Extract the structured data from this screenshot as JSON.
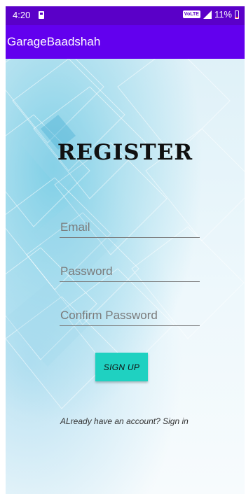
{
  "status_bar": {
    "time": "4:20",
    "network_badge": "VoLTE",
    "battery": "11%",
    "icons": [
      "sd-card-icon",
      "signal-icon",
      "battery-icon"
    ]
  },
  "app_bar": {
    "title": "GarageBaadshah"
  },
  "form": {
    "heading": "REGISTER",
    "email_placeholder": "Email",
    "password_placeholder": "Password",
    "confirm_password_placeholder": "Confirm Password",
    "signup_label": "SIGN UP",
    "signin_text": "ALready have an account? Sign in"
  },
  "colors": {
    "status_bar": "#5a00c8",
    "app_bar": "#6200ee",
    "button": "#1fd1c1"
  }
}
